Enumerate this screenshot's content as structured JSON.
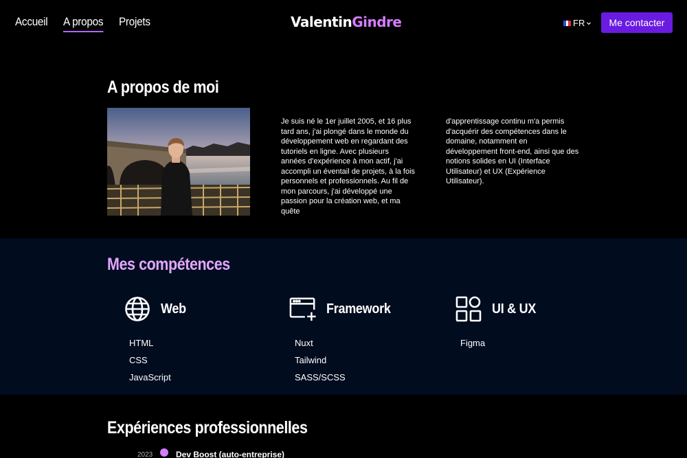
{
  "nav": {
    "items": [
      {
        "label": "Accueil",
        "active": false
      },
      {
        "label": "A propos",
        "active": true
      },
      {
        "label": "Projets",
        "active": false
      }
    ]
  },
  "logo": {
    "first": "Valentin",
    "last": "Gindre"
  },
  "lang": {
    "code": "FR",
    "icon": "france-flag-icon"
  },
  "header": {
    "contact_label": "Me contacter"
  },
  "about": {
    "title": "A propos de moi",
    "col1": "Je suis né le 1er juillet 2005, et 16 plus tard ans, j'ai plongé dans le monde du développement web en regardant des tutoriels en ligne. Avec plusieurs années d'expérience à mon actif, j'ai accompli un éventail de projets, à la fois personnels et professionnels. Au fil de mon parcours, j'ai développé une passion pour la création web, et ma quête",
    "col2": "d'apprentissage continu m'a permis d'acquérir des compétences dans le domaine, notamment en développement front-end, ainsi que des notions solides en UI (Interface Utilisateur) et UX (Expérience Utilisateur)."
  },
  "skills": {
    "title": "Mes compétences",
    "groups": [
      {
        "name": "Web",
        "icon": "globe-icon",
        "items": [
          "HTML",
          "CSS",
          "JavaScript"
        ]
      },
      {
        "name": "Framework",
        "icon": "browser-add-icon",
        "items": [
          "Nuxt",
          "Tailwind",
          "SASS/SCSS"
        ]
      },
      {
        "name": "UI & UX",
        "icon": "grid-squares-icon",
        "items": [
          "Figma"
        ]
      }
    ]
  },
  "experiences": {
    "title": "Expériences professionnelles",
    "items": [
      {
        "year": "2023",
        "name": "Dev Boost (auto-entreprise)"
      }
    ]
  },
  "colors": {
    "accent": "#d57cff",
    "button": "#6a1be0",
    "skills_bg": "#020c1f",
    "active_underline": "#b266ff"
  }
}
